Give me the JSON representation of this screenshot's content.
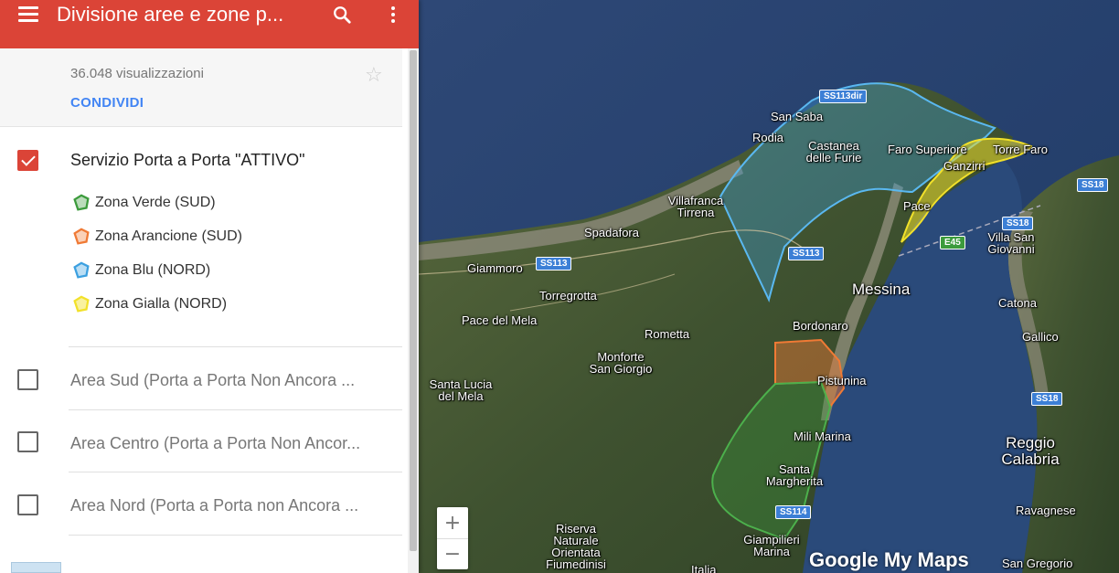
{
  "header": {
    "title": "Divisione aree e zone p...",
    "menu_icon": "hamburger-menu-icon",
    "search_icon": "search-icon",
    "more_icon": "more-vert-icon",
    "color": "#db4437"
  },
  "info": {
    "views": "36.048 visualizzazioni",
    "share_label": "CONDIVIDI",
    "star_icon": "star-outline-icon"
  },
  "layers": [
    {
      "title": "Servizio Porta a Porta \"ATTIVO\"",
      "checked": true,
      "items": [
        {
          "label": "Zona Verde (SUD)",
          "color": "#3c9b3c"
        },
        {
          "label": "Zona Arancione (SUD)",
          "color": "#f07a35"
        },
        {
          "label": "Zona Blu (NORD)",
          "color": "#3ca0e0"
        },
        {
          "label": "Zona Gialla (NORD)",
          "color": "#f2e12a"
        }
      ]
    },
    {
      "title": "Area Sud (Porta a Porta Non Ancora ...",
      "checked": false
    },
    {
      "title": "Area Centro (Porta a Porta Non Ancor...",
      "checked": false
    },
    {
      "title": "Area Nord (Porta a Porta non Ancora ...",
      "checked": false
    }
  ],
  "map": {
    "labels": [
      "San Saba",
      "Rodia",
      "Castanea delle Furie",
      "Faro Superiore",
      "Torre Faro",
      "Ganzirri",
      "Villafranca Tirrena",
      "Spadafora",
      "Pace",
      "Giammoro",
      "Torregrotta",
      "Messina",
      "Pace del Mela",
      "Bordonaro",
      "Rometta",
      "Monforte San Giorgio",
      "Pistunina",
      "Santa Lucia del Mela",
      "Mili Marina",
      "Santa Margherita",
      "Villa San Giovanni",
      "Catona",
      "Gallico",
      "Reggio Calabria",
      "Ravagnese",
      "Riserva Naturale Orientata Fiumedinisi",
      "Giampilieri Marina",
      "San Gregorio",
      "Italia"
    ],
    "roads": [
      "SS113dir",
      "SS113",
      "SS113",
      "SS18",
      "SS18",
      "SS18",
      "E45",
      "SS114"
    ],
    "zoom_in": "+",
    "zoom_out": "−",
    "brand": "Google My Maps"
  }
}
